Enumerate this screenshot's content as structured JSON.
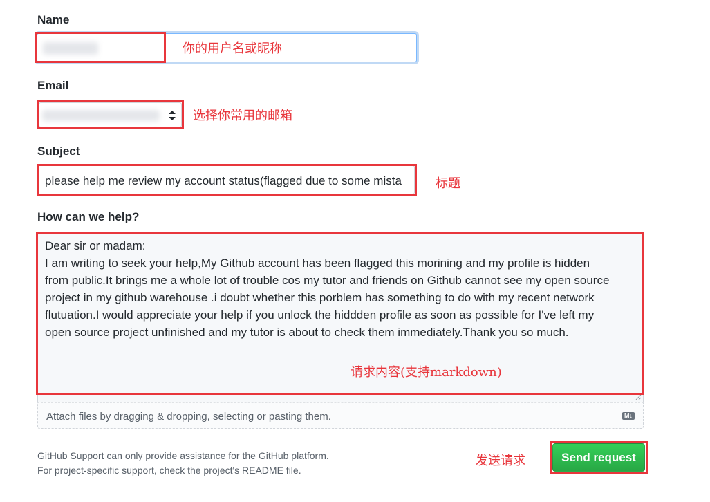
{
  "form": {
    "name_label": "Name",
    "email_label": "Email",
    "subject_label": "Subject",
    "subject_value": "please help me review my account status(flagged due to some mista",
    "help_label": "How can we help?",
    "body_lines": [
      "Dear sir or madam:",
      "  I am writing to seek your help,My Github account has been flagged this morining and my profile is hidden",
      "from public.It brings me a whole lot of trouble cos my tutor and friends on Github cannot see my open source",
      "project in my github warehouse .i doubt whether this porblem has something to do with my recent network",
      "flutuation.I would appreciate your help if you unlock the hiddden profile as soon as possible for I've left my",
      "open  source project unfinished and my tutor is about to check them immediately.Thank you so much."
    ],
    "attach_text": "Attach files by dragging & dropping, selecting or pasting them.",
    "markdown_badge": "M↓",
    "note_line1": "GitHub Support can only provide assistance for the GitHub platform.",
    "note_line2": "For project-specific support, check the project's README file.",
    "send_label": "Send request"
  },
  "annotations": {
    "name": "你的用户名或昵称",
    "email": "选择你常用的邮箱",
    "subject": "标题",
    "body": "请求内容(支持markdown)",
    "send": "发送请求"
  },
  "colors": {
    "annotation_red": "#e8363c",
    "button_green": "#2ea44f",
    "focus_blue": "#79b8ff"
  },
  "icons": {
    "select_arrows": "updown-arrows-icon",
    "markdown": "markdown-icon",
    "resize": "resize-handle-icon"
  }
}
